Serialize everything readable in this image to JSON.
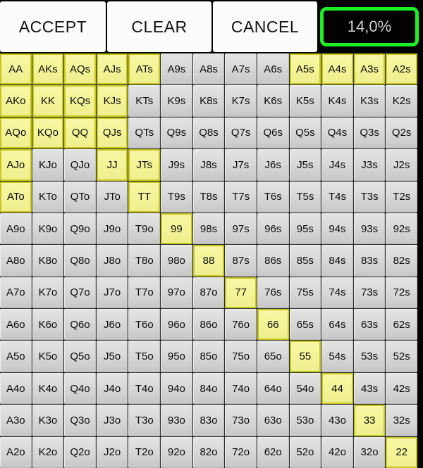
{
  "toolbar": {
    "accept_label": "ACCEPT",
    "clear_label": "CLEAR",
    "cancel_label": "CANCEL",
    "percent_label": "14,0%",
    "percent_border_color": "#1cf024",
    "percent_text_color": "#cfcfcf",
    "button_bg_color": "#fbfbf9"
  },
  "grid": {
    "rows": 13,
    "cols": 13,
    "selected_color": "#f4f49a",
    "selected_border_color": "#c6c61f",
    "unselected_color": "#d8d8d8",
    "ranks": [
      "A",
      "K",
      "Q",
      "J",
      "T",
      "9",
      "8",
      "7",
      "6",
      "5",
      "4",
      "3",
      "2"
    ],
    "cells": [
      [
        {
          "label": "AA",
          "selected": true
        },
        {
          "label": "AKs",
          "selected": true
        },
        {
          "label": "AQs",
          "selected": true
        },
        {
          "label": "AJs",
          "selected": true
        },
        {
          "label": "ATs",
          "selected": true
        },
        {
          "label": "A9s",
          "selected": false
        },
        {
          "label": "A8s",
          "selected": false
        },
        {
          "label": "A7s",
          "selected": false
        },
        {
          "label": "A6s",
          "selected": false
        },
        {
          "label": "A5s",
          "selected": true
        },
        {
          "label": "A4s",
          "selected": true
        },
        {
          "label": "A3s",
          "selected": true
        },
        {
          "label": "A2s",
          "selected": true
        }
      ],
      [
        {
          "label": "AKo",
          "selected": true
        },
        {
          "label": "KK",
          "selected": true
        },
        {
          "label": "KQs",
          "selected": true
        },
        {
          "label": "KJs",
          "selected": true
        },
        {
          "label": "KTs",
          "selected": false
        },
        {
          "label": "K9s",
          "selected": false
        },
        {
          "label": "K8s",
          "selected": false
        },
        {
          "label": "K7s",
          "selected": false
        },
        {
          "label": "K6s",
          "selected": false
        },
        {
          "label": "K5s",
          "selected": false
        },
        {
          "label": "K4s",
          "selected": false
        },
        {
          "label": "K3s",
          "selected": false
        },
        {
          "label": "K2s",
          "selected": false
        }
      ],
      [
        {
          "label": "AQo",
          "selected": true
        },
        {
          "label": "KQo",
          "selected": true
        },
        {
          "label": "QQ",
          "selected": true
        },
        {
          "label": "QJs",
          "selected": true
        },
        {
          "label": "QTs",
          "selected": false
        },
        {
          "label": "Q9s",
          "selected": false
        },
        {
          "label": "Q8s",
          "selected": false
        },
        {
          "label": "Q7s",
          "selected": false
        },
        {
          "label": "Q6s",
          "selected": false
        },
        {
          "label": "Q5s",
          "selected": false
        },
        {
          "label": "Q4s",
          "selected": false
        },
        {
          "label": "Q3s",
          "selected": false
        },
        {
          "label": "Q2s",
          "selected": false
        }
      ],
      [
        {
          "label": "AJo",
          "selected": true
        },
        {
          "label": "KJo",
          "selected": false
        },
        {
          "label": "QJo",
          "selected": false
        },
        {
          "label": "JJ",
          "selected": true
        },
        {
          "label": "JTs",
          "selected": true
        },
        {
          "label": "J9s",
          "selected": false
        },
        {
          "label": "J8s",
          "selected": false
        },
        {
          "label": "J7s",
          "selected": false
        },
        {
          "label": "J6s",
          "selected": false
        },
        {
          "label": "J5s",
          "selected": false
        },
        {
          "label": "J4s",
          "selected": false
        },
        {
          "label": "J3s",
          "selected": false
        },
        {
          "label": "J2s",
          "selected": false
        }
      ],
      [
        {
          "label": "ATo",
          "selected": true
        },
        {
          "label": "KTo",
          "selected": false
        },
        {
          "label": "QTo",
          "selected": false
        },
        {
          "label": "JTo",
          "selected": false
        },
        {
          "label": "TT",
          "selected": true
        },
        {
          "label": "T9s",
          "selected": false
        },
        {
          "label": "T8s",
          "selected": false
        },
        {
          "label": "T7s",
          "selected": false
        },
        {
          "label": "T6s",
          "selected": false
        },
        {
          "label": "T5s",
          "selected": false
        },
        {
          "label": "T4s",
          "selected": false
        },
        {
          "label": "T3s",
          "selected": false
        },
        {
          "label": "T2s",
          "selected": false
        }
      ],
      [
        {
          "label": "A9o",
          "selected": false
        },
        {
          "label": "K9o",
          "selected": false
        },
        {
          "label": "Q9o",
          "selected": false
        },
        {
          "label": "J9o",
          "selected": false
        },
        {
          "label": "T9o",
          "selected": false
        },
        {
          "label": "99",
          "selected": true
        },
        {
          "label": "98s",
          "selected": false
        },
        {
          "label": "97s",
          "selected": false
        },
        {
          "label": "96s",
          "selected": false
        },
        {
          "label": "95s",
          "selected": false
        },
        {
          "label": "94s",
          "selected": false
        },
        {
          "label": "93s",
          "selected": false
        },
        {
          "label": "92s",
          "selected": false
        }
      ],
      [
        {
          "label": "A8o",
          "selected": false
        },
        {
          "label": "K8o",
          "selected": false
        },
        {
          "label": "Q8o",
          "selected": false
        },
        {
          "label": "J8o",
          "selected": false
        },
        {
          "label": "T8o",
          "selected": false
        },
        {
          "label": "98o",
          "selected": false
        },
        {
          "label": "88",
          "selected": true
        },
        {
          "label": "87s",
          "selected": false
        },
        {
          "label": "86s",
          "selected": false
        },
        {
          "label": "85s",
          "selected": false
        },
        {
          "label": "84s",
          "selected": false
        },
        {
          "label": "83s",
          "selected": false
        },
        {
          "label": "82s",
          "selected": false
        }
      ],
      [
        {
          "label": "A7o",
          "selected": false
        },
        {
          "label": "K7o",
          "selected": false
        },
        {
          "label": "Q7o",
          "selected": false
        },
        {
          "label": "J7o",
          "selected": false
        },
        {
          "label": "T7o",
          "selected": false
        },
        {
          "label": "97o",
          "selected": false
        },
        {
          "label": "87o",
          "selected": false
        },
        {
          "label": "77",
          "selected": true
        },
        {
          "label": "76s",
          "selected": false
        },
        {
          "label": "75s",
          "selected": false
        },
        {
          "label": "74s",
          "selected": false
        },
        {
          "label": "73s",
          "selected": false
        },
        {
          "label": "72s",
          "selected": false
        }
      ],
      [
        {
          "label": "A6o",
          "selected": false
        },
        {
          "label": "K6o",
          "selected": false
        },
        {
          "label": "Q6o",
          "selected": false
        },
        {
          "label": "J6o",
          "selected": false
        },
        {
          "label": "T6o",
          "selected": false
        },
        {
          "label": "96o",
          "selected": false
        },
        {
          "label": "86o",
          "selected": false
        },
        {
          "label": "76o",
          "selected": false
        },
        {
          "label": "66",
          "selected": true
        },
        {
          "label": "65s",
          "selected": false
        },
        {
          "label": "64s",
          "selected": false
        },
        {
          "label": "63s",
          "selected": false
        },
        {
          "label": "62s",
          "selected": false
        }
      ],
      [
        {
          "label": "A5o",
          "selected": false
        },
        {
          "label": "K5o",
          "selected": false
        },
        {
          "label": "Q5o",
          "selected": false
        },
        {
          "label": "J5o",
          "selected": false
        },
        {
          "label": "T5o",
          "selected": false
        },
        {
          "label": "95o",
          "selected": false
        },
        {
          "label": "85o",
          "selected": false
        },
        {
          "label": "75o",
          "selected": false
        },
        {
          "label": "65o",
          "selected": false
        },
        {
          "label": "55",
          "selected": true
        },
        {
          "label": "54s",
          "selected": false
        },
        {
          "label": "53s",
          "selected": false
        },
        {
          "label": "52s",
          "selected": false
        }
      ],
      [
        {
          "label": "A4o",
          "selected": false
        },
        {
          "label": "K4o",
          "selected": false
        },
        {
          "label": "Q4o",
          "selected": false
        },
        {
          "label": "J4o",
          "selected": false
        },
        {
          "label": "T4o",
          "selected": false
        },
        {
          "label": "94o",
          "selected": false
        },
        {
          "label": "84o",
          "selected": false
        },
        {
          "label": "74o",
          "selected": false
        },
        {
          "label": "64o",
          "selected": false
        },
        {
          "label": "54o",
          "selected": false
        },
        {
          "label": "44",
          "selected": true
        },
        {
          "label": "43s",
          "selected": false
        },
        {
          "label": "42s",
          "selected": false
        }
      ],
      [
        {
          "label": "A3o",
          "selected": false
        },
        {
          "label": "K3o",
          "selected": false
        },
        {
          "label": "Q3o",
          "selected": false
        },
        {
          "label": "J3o",
          "selected": false
        },
        {
          "label": "T3o",
          "selected": false
        },
        {
          "label": "93o",
          "selected": false
        },
        {
          "label": "83o",
          "selected": false
        },
        {
          "label": "73o",
          "selected": false
        },
        {
          "label": "63o",
          "selected": false
        },
        {
          "label": "53o",
          "selected": false
        },
        {
          "label": "43o",
          "selected": false
        },
        {
          "label": "33",
          "selected": true
        },
        {
          "label": "32s",
          "selected": false
        }
      ],
      [
        {
          "label": "A2o",
          "selected": false
        },
        {
          "label": "K2o",
          "selected": false
        },
        {
          "label": "Q2o",
          "selected": false
        },
        {
          "label": "J2o",
          "selected": false
        },
        {
          "label": "T2o",
          "selected": false
        },
        {
          "label": "92o",
          "selected": false
        },
        {
          "label": "82o",
          "selected": false
        },
        {
          "label": "72o",
          "selected": false
        },
        {
          "label": "62o",
          "selected": false
        },
        {
          "label": "52o",
          "selected": false
        },
        {
          "label": "42o",
          "selected": false
        },
        {
          "label": "32o",
          "selected": false
        },
        {
          "label": "22",
          "selected": true
        }
      ]
    ]
  }
}
